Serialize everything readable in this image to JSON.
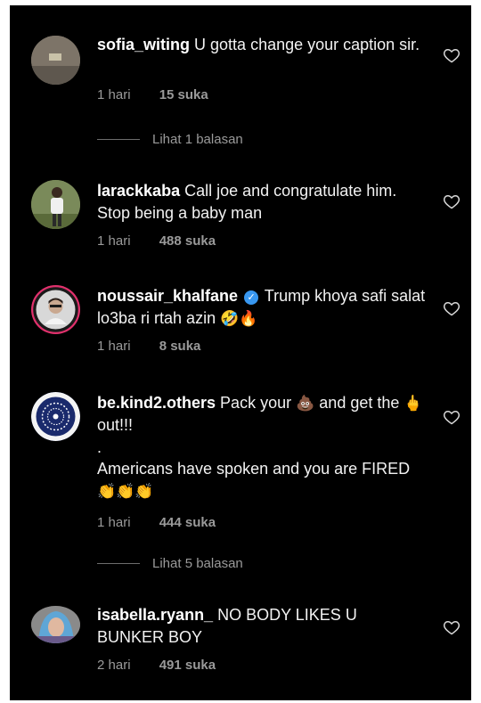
{
  "comments": [
    {
      "username": "sofia_witing",
      "text": "U gotta change your caption sir.",
      "time": "1 hari",
      "likes": "15 suka",
      "replies": "Lihat 1 balasan",
      "avatar_color": "#7d7468"
    },
    {
      "username": "larackkaba",
      "text": "Call joe and congratulate him. Stop being a baby man",
      "time": "1 hari",
      "likes": "488 suka",
      "avatar_color": "#6a7a4a"
    },
    {
      "username": "noussair_khalfane",
      "verified": true,
      "text": "Trump khoya safi salat lo3ba ri rtah azin",
      "emoji": "🤣🔥",
      "time": "1 hari",
      "likes": "8 suka",
      "avatar_color": "#e0e0e0"
    },
    {
      "username": "be.kind2.others",
      "text_part1": "Pack your",
      "emoji1": "💩",
      "text_part2": "and get the",
      "emoji2": "🖕",
      "text_part3": "out!!!",
      "line2": ".",
      "line3": "Americans have spoken and you are FIRED",
      "emoji3": "👏👏👏",
      "time": "1 hari",
      "likes": "444 suka",
      "replies": "Lihat 5 balasan",
      "avatar_color": "#1a2a6c"
    },
    {
      "username": "isabella.ryann_",
      "text": "NO BODY LIKES U BUNKER BOY",
      "time": "2 hari",
      "likes": "491 suka",
      "avatar_color": "#6fa6c9"
    }
  ],
  "colors": {
    "background": "#000000",
    "text": "#f2f2f2",
    "secondary": "#9a9a9a",
    "verified": "#3897f0"
  }
}
